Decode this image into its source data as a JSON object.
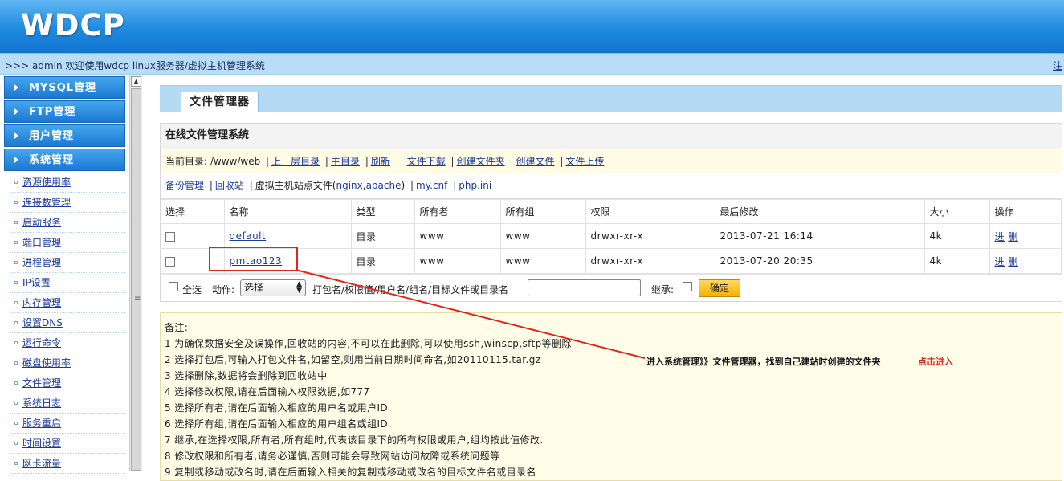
{
  "header": {
    "logo": "WDCP",
    "welcome": ">>> admin 欢迎使用wdcp linux服务器/虚拟主机管理系统",
    "logout": "注"
  },
  "sidebar": {
    "categories": [
      {
        "label": "MYSQL管理"
      },
      {
        "label": "FTP管理"
      },
      {
        "label": "用户管理"
      },
      {
        "label": "系统管理"
      }
    ],
    "items": [
      {
        "label": "资源使用率"
      },
      {
        "label": "连接数管理"
      },
      {
        "label": "启动服务"
      },
      {
        "label": "端口管理"
      },
      {
        "label": "进程管理"
      },
      {
        "label": "IP设置"
      },
      {
        "label": "内存管理"
      },
      {
        "label": "设置DNS"
      },
      {
        "label": "运行命令"
      },
      {
        "label": "磁盘使用率"
      },
      {
        "label": "文件管理"
      },
      {
        "label": "系统日志"
      },
      {
        "label": "服务重启"
      },
      {
        "label": "时间设置"
      },
      {
        "label": "网卡流量"
      }
    ]
  },
  "main": {
    "tab_title": "文件管理器",
    "panel_title": "在线文件管理系统",
    "current_dir_label": "当前目录: /www/web",
    "toolbar1": {
      "up": "上一层目录",
      "root": "主目录",
      "refresh": "刷新",
      "download": "文件下载",
      "mkdir": "创建文件夹",
      "mkfile": "创建文件",
      "upload": "文件上传"
    },
    "toolbar2": {
      "backup": "备份管理",
      "recycle": "回收站",
      "vhost_prefix": "虚拟主机站点文件(",
      "nginx": "nginx",
      "comma": ",",
      "apache": "apache",
      "vhost_suffix": ")",
      "mycnf": "my.cnf",
      "phpini": "php.ini"
    },
    "columns": [
      "选择",
      "名称",
      "类型",
      "所有者",
      "所有组",
      "权限",
      "最后修改",
      "大小",
      "操作"
    ],
    "rows": [
      {
        "name": "default",
        "type": "目录",
        "owner": "www",
        "group": "www",
        "perm": "drwxr-xr-x",
        "mtime": "2013-07-21 16:14",
        "size": "4k",
        "op_enter": "进",
        "op_delete": "删"
      },
      {
        "name": "pmtao123",
        "type": "目录",
        "owner": "www",
        "group": "www",
        "perm": "drwxr-xr-x",
        "mtime": "2013-07-20 20:35",
        "size": "4k",
        "op_enter": "进",
        "op_delete": "删"
      }
    ],
    "actions": {
      "select_all": "全选",
      "action_label": "动作:",
      "action_value": "选择",
      "hint": "打包名/权限值/用户名/组名/目标文件或目录名",
      "inherit": "继承:",
      "confirm": "确定"
    },
    "notes": [
      "备注:",
      "1 为确保数据安全及误操作,回收站的内容,不可以在此删除,可以使用ssh,winscp,sftp等删除",
      "2 选择打包后,可输入打包文件名,如留空,则用当前日期时间命名,如20110115.tar.gz",
      "3 选择删除,数据将会删除到回收站中",
      "4 选择修改权限,请在后面输入权限数据,如777",
      "5 选择所有者,请在后面输入相应的用户名或用户ID",
      "6 选择所有组,请在后面输入相应的用户组名或组ID",
      "7 继承,在选择权限,所有者,所有组时,代表该目录下的所有权限或用户,组均按此值修改.",
      "8 修改权限和所有者,请务必谨慎,否则可能会导致网站访问故障或系统问题等",
      "9 复制或移动或改名时,请在后面输入相关的复制或移动或改名的目标文件名或目录名"
    ]
  },
  "annotation": {
    "text": "进入系统管理》》文件管理器，找到自己建站时创建的文件夹",
    "click": "点击进入",
    "color": "#e0261c"
  }
}
